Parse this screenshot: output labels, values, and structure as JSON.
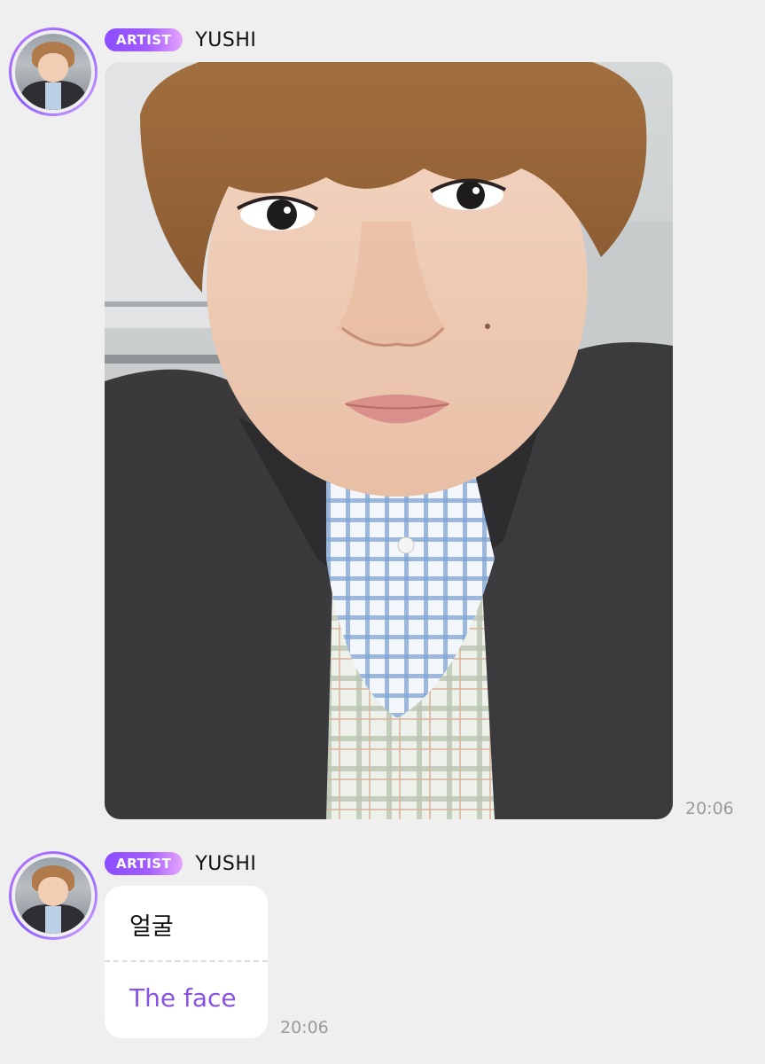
{
  "messages": [
    {
      "badge": "ARTIST",
      "sender": "YUSHI",
      "type": "photo",
      "time": "20:06"
    },
    {
      "badge": "ARTIST",
      "sender": "YUSHI",
      "type": "text",
      "original_text": "얼굴",
      "translated_text": "The face",
      "time": "20:06"
    }
  ],
  "colors": {
    "background": "#efefef",
    "badge_gradient_start": "#8a4dff",
    "badge_gradient_end": "#e6a6ff",
    "translation_text": "#8a52e0",
    "timestamp": "#9b9b9b"
  }
}
